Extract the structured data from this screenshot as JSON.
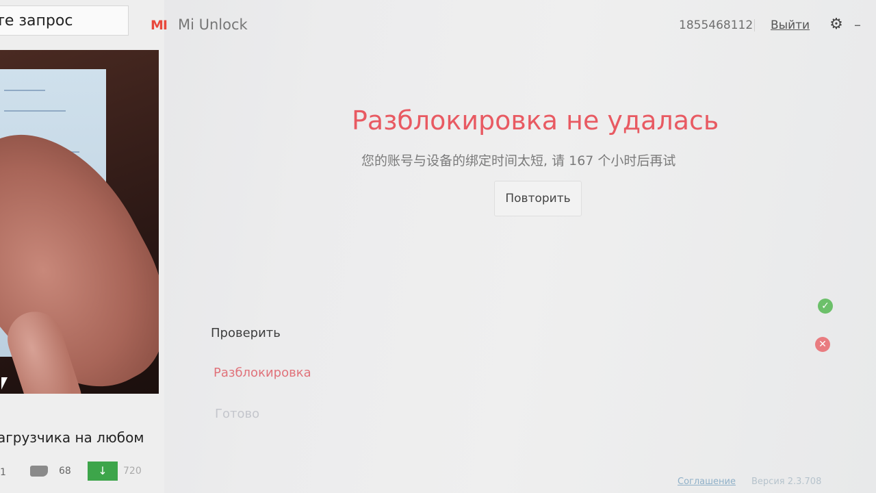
{
  "browser": {
    "search_text": "те запрос",
    "video_title": "агрузчика на любом",
    "left_count": "1",
    "dislike_count": "68",
    "download_count": "720",
    "download_icon": "↓"
  },
  "app": {
    "logo_text": "MI",
    "title": "Mi Unlock",
    "account_id": "1855468112",
    "logout_label": "Выйти",
    "settings_icon": "⚙",
    "minimize_icon": "–"
  },
  "result": {
    "title": "Разблокировка не удалась",
    "message": "您的账号与设备的绑定时间太短, 请 167 个小时后再试",
    "retry_label": "Повторить"
  },
  "steps": [
    {
      "label": "Проверить",
      "status": "ok"
    },
    {
      "label": "Разблокировка",
      "status": "failed"
    },
    {
      "label": "Готово",
      "status": "pending"
    }
  ],
  "status_icons": {
    "ok": "✓",
    "fail": "✕"
  },
  "footer": {
    "agreement": "Соглашение",
    "version": "Версия 2.3.708"
  },
  "colors": {
    "accent_red": "#e85a62",
    "logo_orange": "#e8483c",
    "ok_green": "#6cc06a",
    "download_green": "#3da54a"
  }
}
